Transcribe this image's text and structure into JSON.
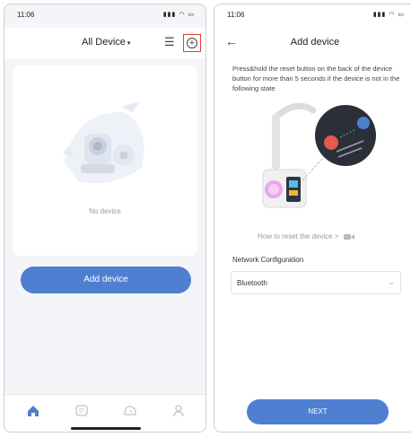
{
  "left_screen": {
    "status_time": "11:06",
    "status_icons": "▮▮▮ ◠ ▭",
    "title": "All Device",
    "caret": "▾",
    "menu_icon": "☰",
    "plus_icon": "+",
    "empty_text": "No device",
    "add_button": "Add device"
  },
  "right_screen": {
    "status_time": "11:06",
    "status_icons": "▮▮▮ ◠ ▭",
    "back_icon": "←",
    "title": "Add device",
    "instruction": "Press&hold the reset button on the back of the device button for more than 5 seconds if the device is not in the following state",
    "reset_link": "How to reset the device >",
    "network_label": "Network Configuration",
    "network_value": "Bluetooth",
    "chevron_icon": "⌄",
    "next_button": "NEXT"
  },
  "colors": {
    "accent": "#4f7fd1",
    "highlight_red": "#e53935"
  }
}
